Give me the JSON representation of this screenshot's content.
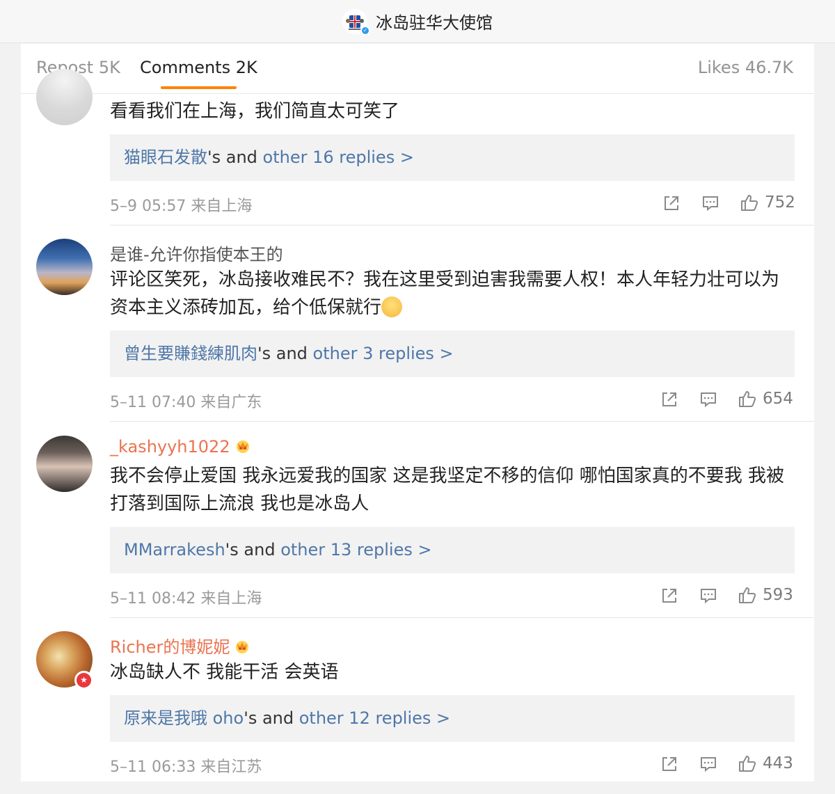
{
  "header": {
    "account_name": "冰岛驻华大使馆"
  },
  "tabs": {
    "repost": "Repost 5K",
    "comments": "Comments 2K",
    "likes": "Likes 46.7K"
  },
  "comments": [
    {
      "username": "",
      "text": "看看我们在上海，我们简直太可笑了",
      "reply_user": "猫眼石发散",
      "reply_mid": "'s and ",
      "reply_link": "other 16 replies >",
      "meta": "5–9 05:57 来自上海",
      "likes": "752"
    },
    {
      "username": "是谁-允许你指使本王的",
      "text": "评论区笑死，冰岛接收难民不？我在这里受到迫害我需要人权！本人年轻力壮可以为资本主义添砖加瓦，给个低保就行",
      "reply_user": "曾生要賺錢練肌肉",
      "reply_mid": "'s and ",
      "reply_link": "other 3 replies >",
      "meta": "5–11 07:40 来自广东",
      "likes": "654"
    },
    {
      "username": "_kashyyh1022",
      "text": "我不会停止爱国 我永远爱我的国家 这是我坚定不移的信仰 哪怕国家真的不要我 我被打落到国际上流浪 我也是冰岛人",
      "reply_user": "MMarrakesh",
      "reply_mid": "'s and ",
      "reply_link": "other 13 replies >",
      "meta": "5–11 08:42 来自上海",
      "likes": "593"
    },
    {
      "username": "Richer的博妮妮",
      "text": "冰岛缺人不 我能干活 会英语",
      "reply_user": "原来是我哦 oho",
      "reply_mid": "'s and ",
      "reply_link": "other 12 replies >",
      "meta": "5–11 06:33 来自江苏",
      "likes": "443"
    }
  ],
  "colors": {
    "accent": "#ff8200",
    "link": "#4e77a8",
    "vip_name": "#eb7350"
  }
}
